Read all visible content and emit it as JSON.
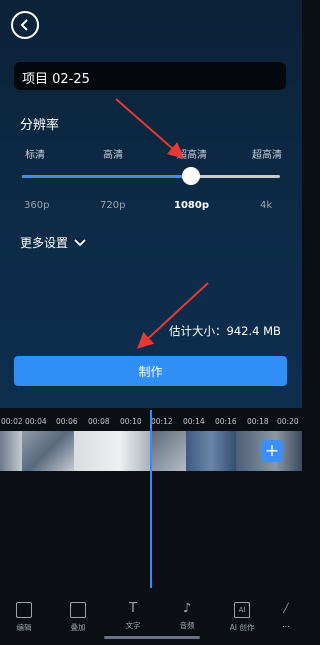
{
  "header": {
    "back_icon": "chevron-left-icon"
  },
  "project": {
    "title": "项目 02-25"
  },
  "resolution": {
    "label": "分辨率",
    "quality_labels": [
      "标清",
      "高清",
      "超高清",
      "超高清"
    ],
    "values": [
      "360p",
      "720p",
      "1080p",
      "4k"
    ],
    "selected": "1080p"
  },
  "more_settings": {
    "label": "更多设置"
  },
  "estimate": {
    "text": "估计大小：942.4 MB"
  },
  "make_button": {
    "label": "制作"
  },
  "timeline": {
    "ticks": [
      "00:02",
      "00:04",
      "00:06",
      "00:08",
      "00:10",
      "00:12",
      "00:14",
      "00:16",
      "00:18",
      "00:20"
    ]
  },
  "toolbar": {
    "items": [
      "编辑",
      "叠加",
      "文字",
      "音频",
      "AI 创作",
      "..."
    ]
  }
}
